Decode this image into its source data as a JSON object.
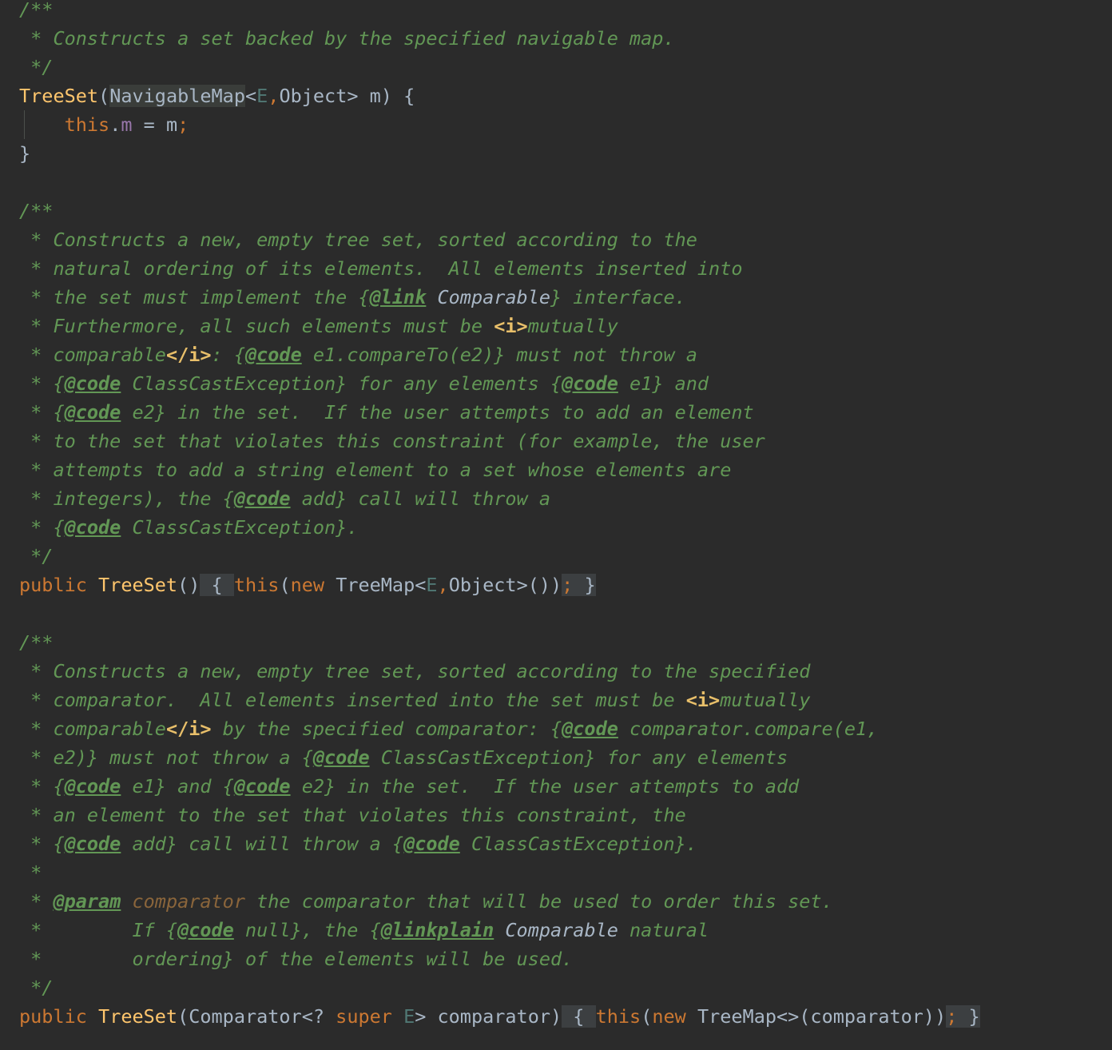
{
  "editor": {
    "lines": [
      [
        {
          "t": "/**",
          "c": "c"
        }
      ],
      [
        {
          "t": " * Constructs a set backed by the specified navigable map.",
          "c": "c"
        }
      ],
      [
        {
          "t": " */",
          "c": "c"
        }
      ],
      [
        {
          "t": "TreeSet",
          "c": "fn"
        },
        {
          "t": "(",
          "c": "ty"
        },
        {
          "t": "NavigableMap",
          "c": "ty hl"
        },
        {
          "t": "<",
          "c": "ty"
        },
        {
          "t": "E",
          "c": "tp"
        },
        {
          "t": ",",
          "c": "kw"
        },
        {
          "t": "Object> m) {",
          "c": "ty"
        }
      ],
      [
        {
          "t": "    ",
          "c": "ty"
        },
        {
          "t": "this",
          "c": "kw"
        },
        {
          "t": ".",
          "c": "ty"
        },
        {
          "t": "m",
          "c": "fld"
        },
        {
          "t": " = m",
          "c": "ty"
        },
        {
          "t": ";",
          "c": "kw"
        }
      ],
      [
        {
          "t": "}",
          "c": "ty"
        }
      ],
      [],
      [
        {
          "t": "/**",
          "c": "c"
        }
      ],
      [
        {
          "t": " * Constructs a new, empty tree set, sorted according to the",
          "c": "c"
        }
      ],
      [
        {
          "t": " * natural ordering of its elements.  All elements inserted into",
          "c": "c"
        }
      ],
      [
        {
          "t": " * the set must implement the {",
          "c": "c"
        },
        {
          "t": "@link",
          "c": "ct"
        },
        {
          "t": " ",
          "c": "c"
        },
        {
          "t": "Comparable",
          "c": "cr"
        },
        {
          "t": "} interface.",
          "c": "c"
        }
      ],
      [
        {
          "t": " * Furthermore, all such elements must be ",
          "c": "c"
        },
        {
          "t": "<i>",
          "c": "ch"
        },
        {
          "t": "mutually",
          "c": "c"
        }
      ],
      [
        {
          "t": " * comparable",
          "c": "c"
        },
        {
          "t": "</i>",
          "c": "ch"
        },
        {
          "t": ": {",
          "c": "c"
        },
        {
          "t": "@code",
          "c": "ct"
        },
        {
          "t": " e1.compareTo(e2)} must not throw a",
          "c": "c"
        }
      ],
      [
        {
          "t": " * {",
          "c": "c"
        },
        {
          "t": "@code",
          "c": "ct"
        },
        {
          "t": " ClassCastException} for any elements {",
          "c": "c"
        },
        {
          "t": "@code",
          "c": "ct"
        },
        {
          "t": " e1} and",
          "c": "c"
        }
      ],
      [
        {
          "t": " * {",
          "c": "c"
        },
        {
          "t": "@code",
          "c": "ct"
        },
        {
          "t": " e2} in the set.  If the user attempts to add an element",
          "c": "c"
        }
      ],
      [
        {
          "t": " * to the set that violates this constraint (for example, the user",
          "c": "c"
        }
      ],
      [
        {
          "t": " * attempts to add a string element to a set whose elements are",
          "c": "c"
        }
      ],
      [
        {
          "t": " * integers), the {",
          "c": "c"
        },
        {
          "t": "@code",
          "c": "ct"
        },
        {
          "t": " add} call will throw a",
          "c": "c"
        }
      ],
      [
        {
          "t": " * {",
          "c": "c"
        },
        {
          "t": "@code",
          "c": "ct"
        },
        {
          "t": " ClassCastException}.",
          "c": "c"
        }
      ],
      [
        {
          "t": " */",
          "c": "c"
        }
      ],
      [
        {
          "t": "public ",
          "c": "kw"
        },
        {
          "t": "TreeSet",
          "c": "fn"
        },
        {
          "t": "()",
          "c": "ty"
        },
        {
          "t": " { ",
          "c": "ty fold"
        },
        {
          "t": "this",
          "c": "kw"
        },
        {
          "t": "(",
          "c": "ty"
        },
        {
          "t": "new ",
          "c": "kw"
        },
        {
          "t": "TreeMap<",
          "c": "ty"
        },
        {
          "t": "E",
          "c": "tp"
        },
        {
          "t": ",",
          "c": "kw"
        },
        {
          "t": "Object>())",
          "c": "ty"
        },
        {
          "t": ";",
          "c": "kw fold"
        },
        {
          "t": " }",
          "c": "ty fold"
        }
      ],
      [],
      [
        {
          "t": "/**",
          "c": "c"
        }
      ],
      [
        {
          "t": " * Constructs a new, empty tree set, sorted according to the specified",
          "c": "c"
        }
      ],
      [
        {
          "t": " * comparator.  All elements inserted into the set must be ",
          "c": "c"
        },
        {
          "t": "<i>",
          "c": "ch"
        },
        {
          "t": "mutually",
          "c": "c"
        }
      ],
      [
        {
          "t": " * comparable",
          "c": "c"
        },
        {
          "t": "</i>",
          "c": "ch"
        },
        {
          "t": " by the specified comparator: {",
          "c": "c"
        },
        {
          "t": "@code",
          "c": "ct"
        },
        {
          "t": " comparator.compare(e1,",
          "c": "c"
        }
      ],
      [
        {
          "t": " * e2)} must not throw a {",
          "c": "c"
        },
        {
          "t": "@code",
          "c": "ct"
        },
        {
          "t": " ClassCastException} for any elements",
          "c": "c"
        }
      ],
      [
        {
          "t": " * {",
          "c": "c"
        },
        {
          "t": "@code",
          "c": "ct"
        },
        {
          "t": " e1} and {",
          "c": "c"
        },
        {
          "t": "@code",
          "c": "ct"
        },
        {
          "t": " e2} in the set.  If the user attempts to add",
          "c": "c"
        }
      ],
      [
        {
          "t": " * an element to the set that violates this constraint, the",
          "c": "c"
        }
      ],
      [
        {
          "t": " * {",
          "c": "c"
        },
        {
          "t": "@code",
          "c": "ct"
        },
        {
          "t": " add} call will throw a {",
          "c": "c"
        },
        {
          "t": "@code",
          "c": "ct"
        },
        {
          "t": " ClassCastException}.",
          "c": "c"
        }
      ],
      [
        {
          "t": " *",
          "c": "c"
        }
      ],
      [
        {
          "t": " * ",
          "c": "c"
        },
        {
          "t": "@param",
          "c": "ct"
        },
        {
          "t": " ",
          "c": "c"
        },
        {
          "t": "comparator",
          "c": "cp"
        },
        {
          "t": " the comparator that will be used to order this set.",
          "c": "c"
        }
      ],
      [
        {
          "t": " *        If {",
          "c": "c"
        },
        {
          "t": "@code",
          "c": "ct"
        },
        {
          "t": " null}, the {",
          "c": "c"
        },
        {
          "t": "@linkplain",
          "c": "ct"
        },
        {
          "t": " ",
          "c": "c"
        },
        {
          "t": "Comparable",
          "c": "cr"
        },
        {
          "t": " natural",
          "c": "c"
        }
      ],
      [
        {
          "t": " *        ordering} of the elements will be used.",
          "c": "c"
        }
      ],
      [
        {
          "t": " */",
          "c": "c"
        }
      ],
      [
        {
          "t": "public ",
          "c": "kw"
        },
        {
          "t": "TreeSet",
          "c": "fn"
        },
        {
          "t": "(Comparator<? ",
          "c": "ty"
        },
        {
          "t": "super ",
          "c": "kw"
        },
        {
          "t": "E",
          "c": "tp"
        },
        {
          "t": "> comparator)",
          "c": "ty"
        },
        {
          "t": " { ",
          "c": "ty fold"
        },
        {
          "t": "this",
          "c": "kw"
        },
        {
          "t": "(",
          "c": "ty"
        },
        {
          "t": "new ",
          "c": "kw"
        },
        {
          "t": "TreeMap<>(comparator))",
          "c": "ty"
        },
        {
          "t": ";",
          "c": "kw fold"
        },
        {
          "t": " }",
          "c": "ty fold"
        }
      ]
    ]
  }
}
